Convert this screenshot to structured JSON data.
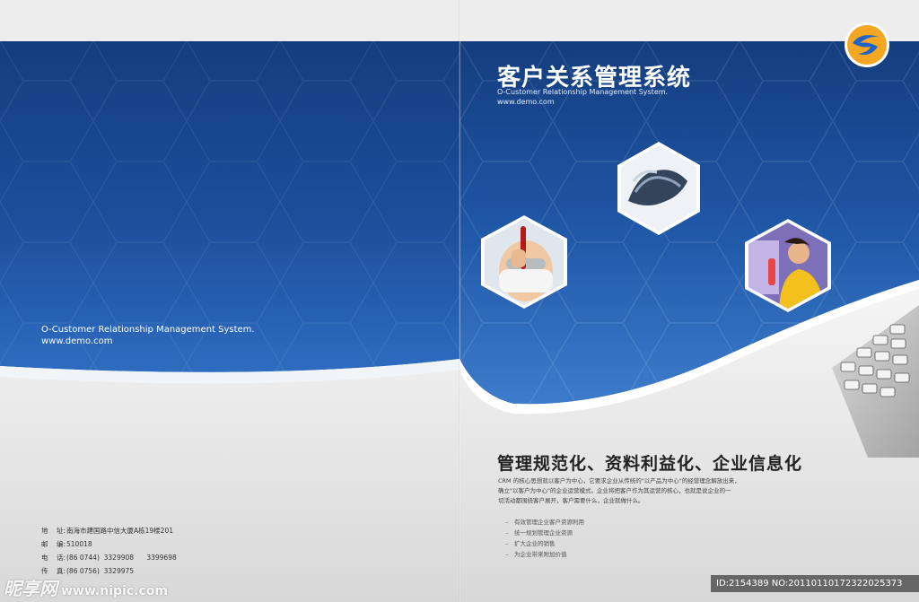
{
  "brochure": {
    "title_cn": "客户关系管理系统",
    "title_en": "O-Customer Relationship Management System.",
    "url": "www.demo.com"
  },
  "left_page": {
    "tagline_en": "O-Customer Relationship Management System.",
    "url": "www.demo.com"
  },
  "right_page": {
    "headline": "管理规范化、资料利益化、企业信息化",
    "body_lines": [
      "CRM 的核心思想就以客户为中心，它要求企业从传统的\"以产品为中心\"的经营理念解放出来，",
      "确立\"以客户为中心\"的企业运营模式。企业将把客户作为其运营的核心，也就是说企业的一",
      "切活动都围绕客户展开，客户需要什么，企业就做什么。"
    ],
    "bullets": [
      "有效管理企业客户资源利用",
      "统一规划管理企业资源",
      "扩大企业的销售",
      "为企业带来附加价值"
    ]
  },
  "contact": [
    {
      "label": "地    址:",
      "value": "南海市建国路中信大厦A栋19楼201"
    },
    {
      "label": "邮    编:",
      "value": "510018"
    },
    {
      "label": "电    话:",
      "value": "(86 0744)  3329908      3399698"
    },
    {
      "label": "传    真:",
      "value": "(86 0756)  3329975"
    }
  ],
  "watermarks": {
    "left": "昵享网",
    "left_url": "www.nipic.com",
    "right": "ID:2154389 NO:20110110172322025373"
  },
  "colors": {
    "blue_dark": "#123a7a",
    "blue_mid": "#1d4f9c",
    "blue_light": "#3c78c6",
    "accent_white": "#ffffff"
  },
  "icons": {
    "logo": "swirl-g-logo"
  }
}
